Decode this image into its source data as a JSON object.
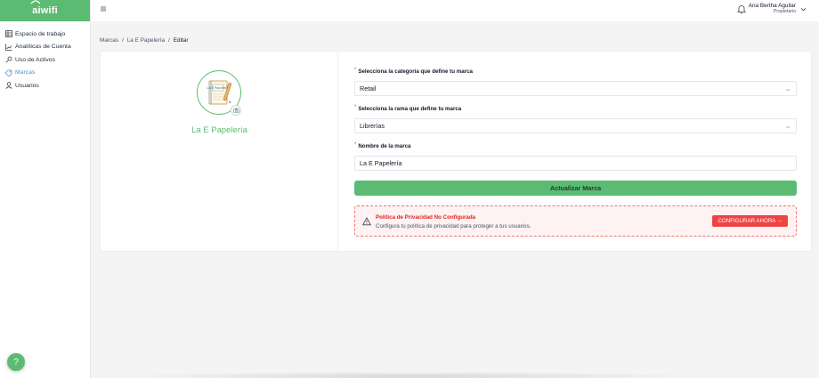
{
  "app": {
    "logo_text": "aiwifi",
    "brand_color": "#5cbb72"
  },
  "sidebar": {
    "items": [
      {
        "label": "Espacio de trabajo",
        "icon": "table-icon",
        "active": false
      },
      {
        "label": "Analíticas de Cuenta",
        "icon": "chart-icon",
        "active": false
      },
      {
        "label": "Uso de Activos",
        "icon": "key-icon",
        "active": false
      },
      {
        "label": "Marcas",
        "icon": "tag-icon",
        "active": true
      },
      {
        "label": "Usuarios",
        "icon": "user-icon",
        "active": false
      }
    ],
    "help_label": "?"
  },
  "header": {
    "user_name": "Ana Bertha Aguilar",
    "user_role": "Propietario"
  },
  "breadcrumb": {
    "items": [
      "Marcas",
      "La E Papelería",
      "Editar"
    ],
    "separator": "/"
  },
  "brand": {
    "name": "La E Papelería",
    "logo_text": "La E Papelería"
  },
  "form": {
    "category_label": "Selecciona la categoría que define tu marca",
    "category_value": "Retail",
    "branch_label": "Selecciona la rama que define tu marca",
    "branch_value": "Librerías",
    "name_label": "Nombre de la marca",
    "name_value": "La E Papelería",
    "required_mark": "*",
    "submit_label": "Actualizar Marca"
  },
  "alert": {
    "title": "Política de Privacidad No Configurada",
    "message": "Configura tu política de privacidad para proteger a tus usuarios.",
    "action_label": "CONFIGURAR AHORA →",
    "color": "#ef4444"
  }
}
